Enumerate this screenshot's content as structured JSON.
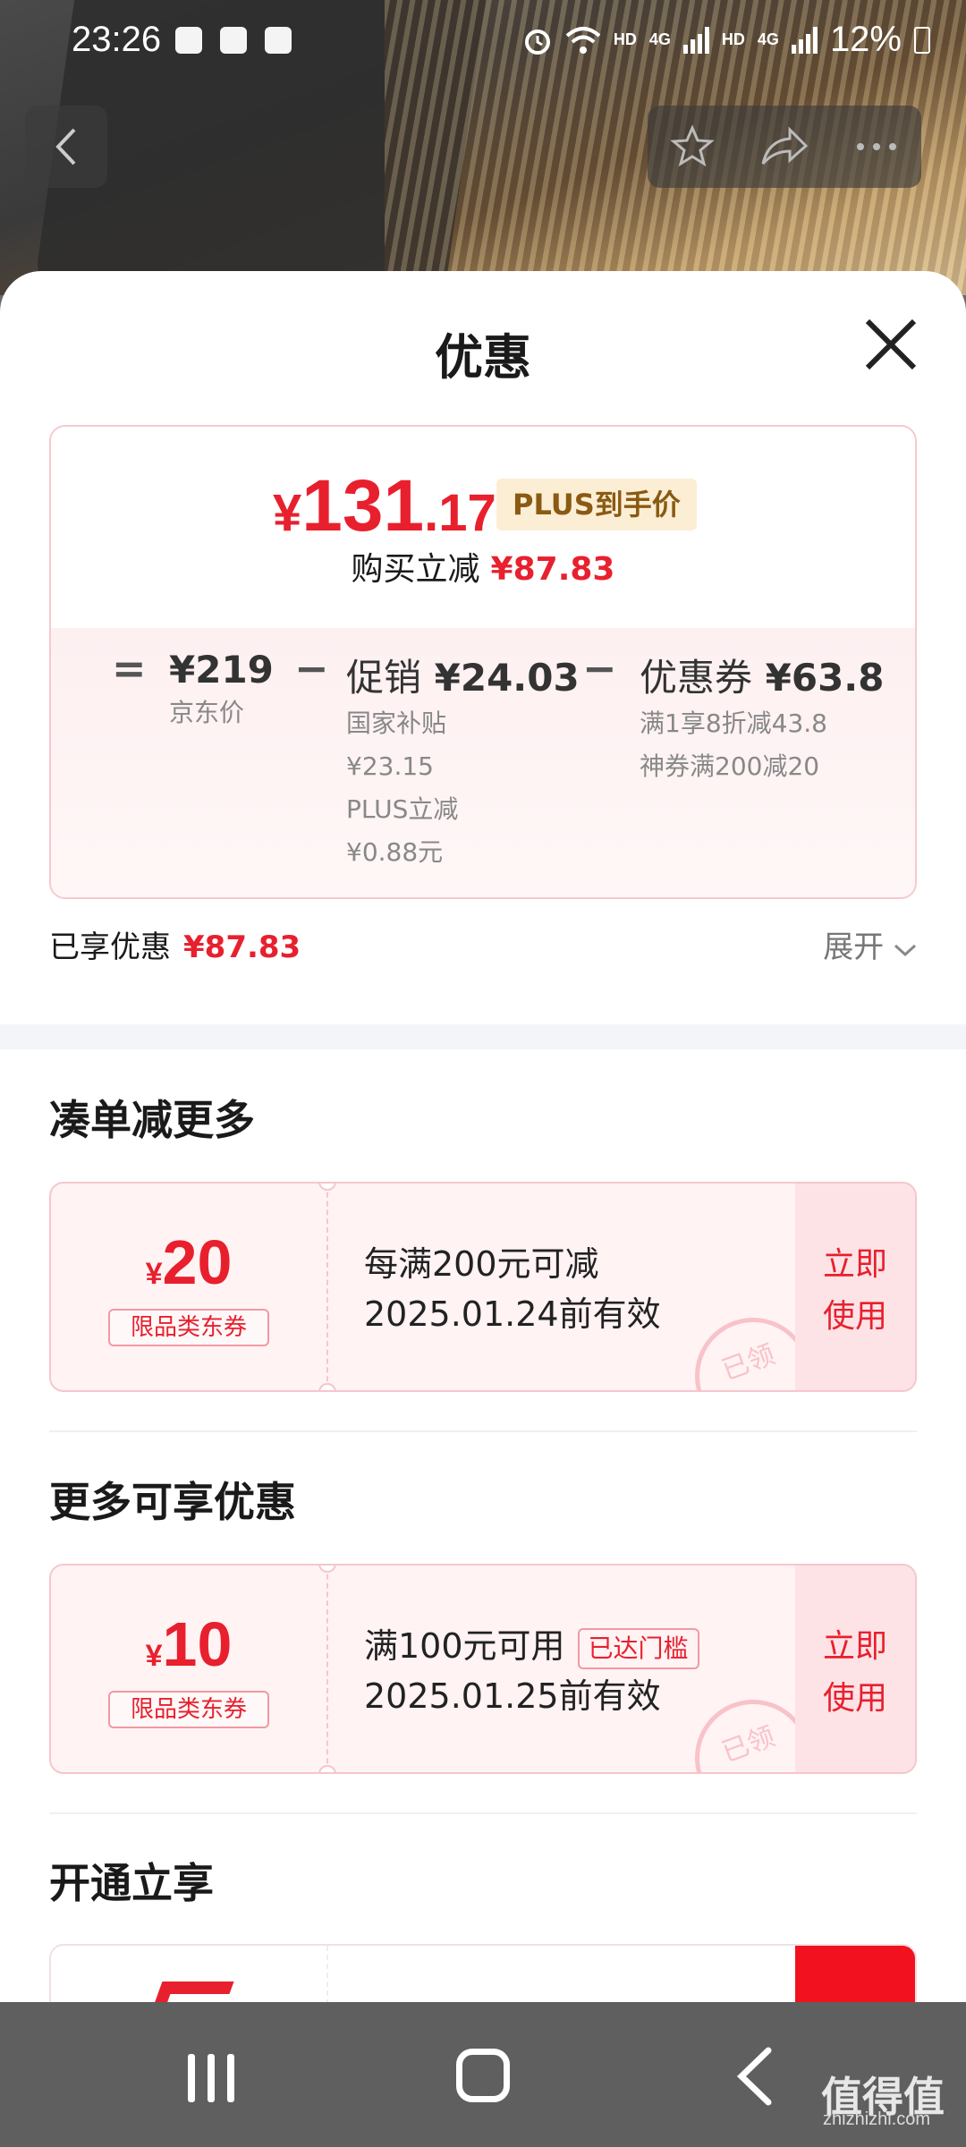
{
  "status_bar": {
    "time": "23:26",
    "hd1": "HD",
    "net1": "4G",
    "hd2": "HD",
    "net2": "4G",
    "battery": "12%"
  },
  "sheet": {
    "title": "优惠"
  },
  "price_card": {
    "yen": "¥",
    "price_int": "131",
    "price_dec": ".17",
    "plus_badge": "PLUS到手价",
    "save_label": "购买立减",
    "save_value": "¥87.83",
    "equals": "=",
    "base_value": "¥219",
    "base_label": "京东价",
    "minus1": "−",
    "promo_label": "促销",
    "promo_value": "¥24.03",
    "promo_sub": [
      "国家补贴",
      "¥23.15",
      "PLUS立减",
      "¥0.88元"
    ],
    "minus2": "−",
    "coupon_label": "优惠券",
    "coupon_value": "¥63.8",
    "coupon_sub": [
      "满1享8折减43.8",
      "神券满200减20"
    ]
  },
  "summary": {
    "enjoyed_label": "已享优惠",
    "enjoyed_value": "¥87.83",
    "expand_label": "展开"
  },
  "section1": {
    "title": "凑单减更多",
    "coupon": {
      "yen": "¥",
      "amount": "20",
      "tag": "限品类东券",
      "line1": "每满200元可减",
      "line2": "2025.01.24前有效",
      "action_line1": "立即",
      "action_line2": "使用",
      "stamp": "已领"
    }
  },
  "section2": {
    "title": "更多可享优惠",
    "coupon": {
      "yen": "¥",
      "amount": "10",
      "tag": "限品类东券",
      "line1": "满100元可用",
      "badge": "已达门槛",
      "line2": "2025.01.25前有效",
      "action_line1": "立即",
      "action_line2": "使用",
      "stamp": "已领"
    }
  },
  "section3": {
    "title": "开通立享"
  },
  "watermark": {
    "main": "值得值",
    "sub": "zhizhizhi.com"
  },
  "colors": {
    "accent_red": "#e8202e",
    "plus_gold": "#8a5a12"
  }
}
